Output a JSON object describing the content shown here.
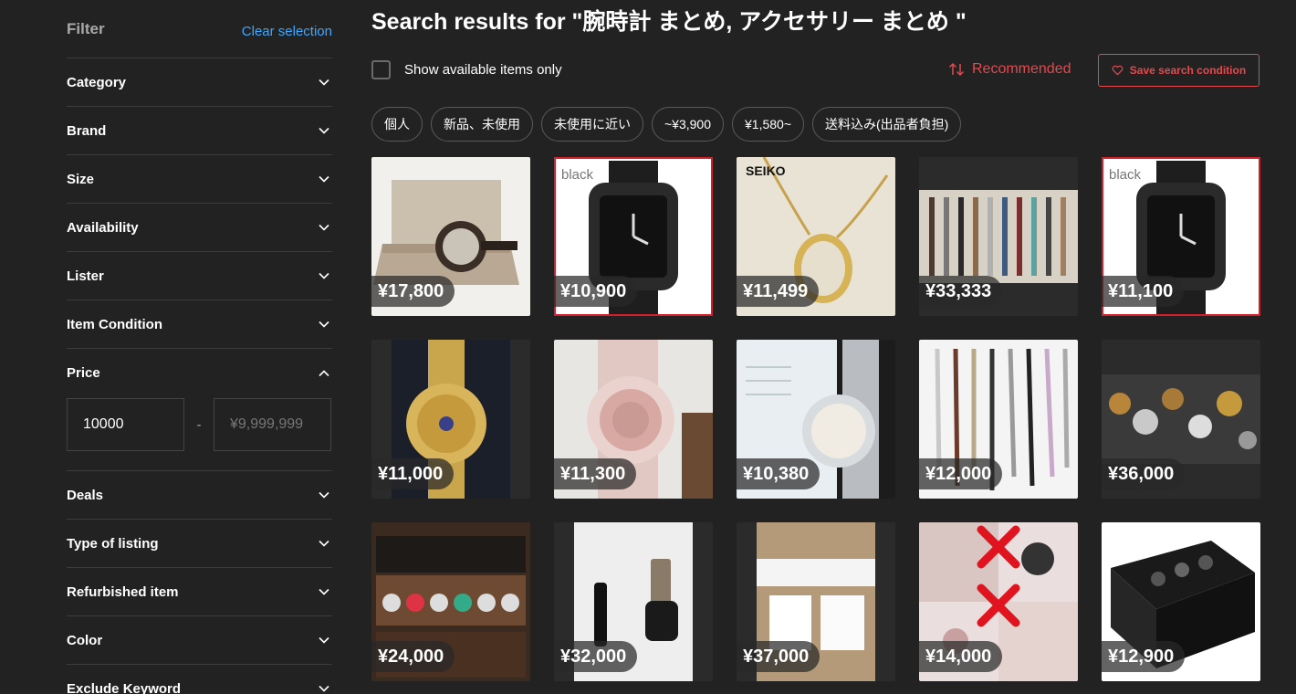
{
  "filter": {
    "title": "Filter",
    "clear_label": "Clear selection",
    "facets_top": [
      "Category",
      "Brand",
      "Size",
      "Availability",
      "Lister",
      "Item Condition"
    ],
    "price_label": "Price",
    "price_min_value": "10000",
    "price_max_placeholder": "¥9,999,999",
    "price_separator": "-",
    "facets_bottom": [
      "Deals",
      "Type of listing",
      "Refurbished item",
      "Color",
      "Exclude Keyword"
    ]
  },
  "main": {
    "search_title": "Search results for \"腕時計 まとめ, アクセサリー まとめ \"",
    "available_only_label": "Show available items only",
    "sort_label": "Recommended",
    "save_label": "Save search condition",
    "chips": [
      "個人",
      "新品、未使用",
      "未使用に近い",
      "~¥3,900",
      "¥1,580~",
      "送料込み(出品者負担)"
    ]
  },
  "items": [
    {
      "price": "¥17,800",
      "thumb": "watch-box"
    },
    {
      "price": "¥10,900",
      "thumb": "black-smartwatch-case"
    },
    {
      "price": "¥11,499",
      "thumb": "seiko-pendant-watch"
    },
    {
      "price": "¥33,333",
      "thumb": "watch-lot-flat"
    },
    {
      "price": "¥11,100",
      "thumb": "black-smartwatch-case"
    },
    {
      "price": "¥11,000",
      "thumb": "gold-iced-watch"
    },
    {
      "price": "¥11,300",
      "thumb": "pink-gshock"
    },
    {
      "price": "¥10,380",
      "thumb": "silver-jeweled-watch"
    },
    {
      "price": "¥12,000",
      "thumb": "watch-lot-hanging"
    },
    {
      "price": "¥36,000",
      "thumb": "watch-jewelry-lot"
    },
    {
      "price": "¥24,000",
      "thumb": "watch-display-case"
    },
    {
      "price": "¥32,000",
      "thumb": "apple-watch-band"
    },
    {
      "price": "¥37,000",
      "thumb": "apple-watch-box"
    },
    {
      "price": "¥14,000",
      "thumb": "accessory-collage"
    },
    {
      "price": "¥12,900",
      "thumb": "black-watch-case"
    }
  ],
  "colors": {
    "background": "#222222",
    "accent_red": "#e5484d",
    "link_blue": "#3ea8ff",
    "divider": "#3c3c3c"
  }
}
